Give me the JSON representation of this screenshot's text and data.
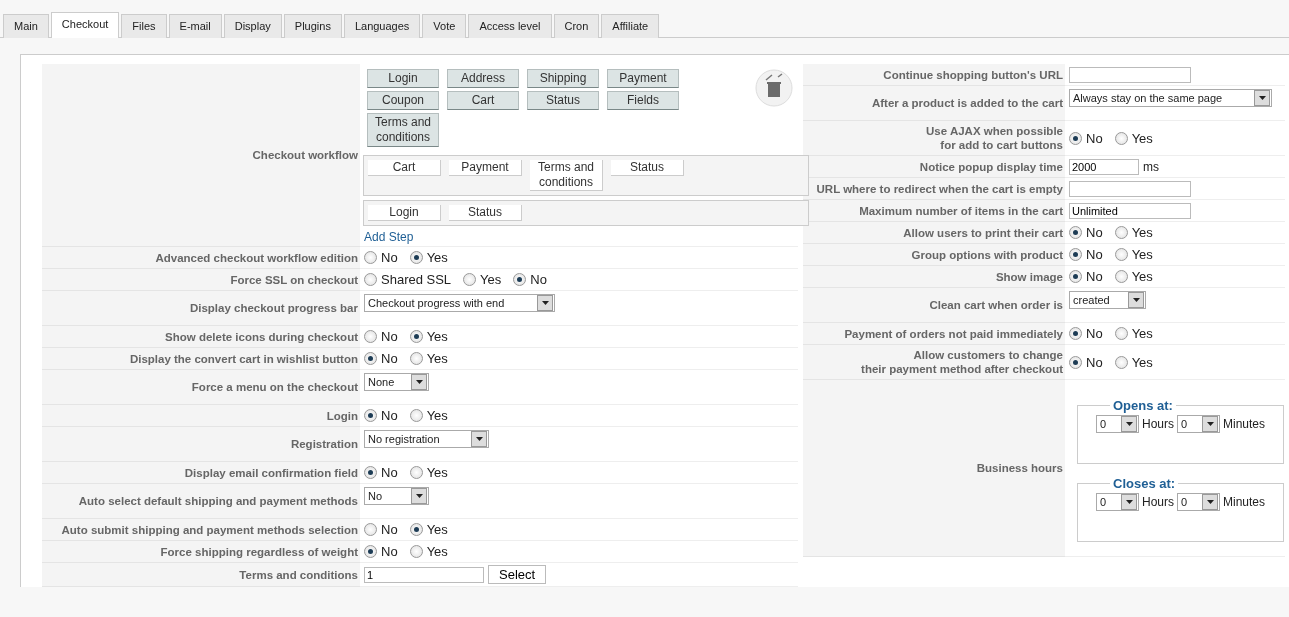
{
  "tabs": [
    {
      "label": "Main",
      "selected": false
    },
    {
      "label": "Checkout",
      "selected": true
    },
    {
      "label": "Files",
      "selected": false
    },
    {
      "label": "E-mail",
      "selected": false
    },
    {
      "label": "Display",
      "selected": false
    },
    {
      "label": "Plugins",
      "selected": false
    },
    {
      "label": "Languages",
      "selected": false
    },
    {
      "label": "Vote",
      "selected": false
    },
    {
      "label": "Access level",
      "selected": false
    },
    {
      "label": "Cron",
      "selected": false
    },
    {
      "label": "Affiliate",
      "selected": false
    }
  ],
  "left_rows": [
    {
      "kind": "workflow",
      "label": "Checkout workflow",
      "available": [
        "Login",
        "Address",
        "Shipping",
        "Payment",
        "Coupon",
        "Cart",
        "Status",
        "Fields",
        "Terms and conditions"
      ],
      "steps": [
        [
          "Cart",
          "Payment",
          "Terms and conditions",
          "Status"
        ],
        [
          "Login",
          "Status"
        ]
      ],
      "add_step": "Add Step"
    },
    {
      "kind": "radio",
      "label": "Advanced checkout workflow edition",
      "options": [
        {
          "label": "No",
          "selected": false
        },
        {
          "label": "Yes",
          "selected": true
        }
      ]
    },
    {
      "kind": "radio",
      "label": "Force SSL on checkout",
      "options": [
        {
          "label": "Shared SSL",
          "selected": false
        },
        {
          "label": "Yes",
          "selected": false
        },
        {
          "label": "No",
          "selected": true
        }
      ]
    },
    {
      "kind": "select",
      "label": "Display checkout progress bar",
      "value": "Checkout progress with end"
    },
    {
      "kind": "radio",
      "label": "Show delete icons during checkout",
      "options": [
        {
          "label": "No",
          "selected": false
        },
        {
          "label": "Yes",
          "selected": true
        }
      ]
    },
    {
      "kind": "radio",
      "label": "Display the convert cart in wishlist button",
      "options": [
        {
          "label": "No",
          "selected": true
        },
        {
          "label": "Yes",
          "selected": false
        }
      ]
    },
    {
      "kind": "select",
      "label": "Force a menu on the checkout",
      "value": "None"
    },
    {
      "kind": "radio",
      "label": "Login",
      "options": [
        {
          "label": "No",
          "selected": true
        },
        {
          "label": "Yes",
          "selected": false
        }
      ]
    },
    {
      "kind": "select",
      "label": "Registration",
      "value": "No registration"
    },
    {
      "kind": "radio",
      "label": "Display email confirmation field",
      "options": [
        {
          "label": "No",
          "selected": true
        },
        {
          "label": "Yes",
          "selected": false
        }
      ]
    },
    {
      "kind": "select",
      "label": "Auto select default shipping and payment methods",
      "value": "No"
    },
    {
      "kind": "radio",
      "label": "Auto submit shipping and payment methods selection",
      "options": [
        {
          "label": "No",
          "selected": false
        },
        {
          "label": "Yes",
          "selected": true
        }
      ]
    },
    {
      "kind": "radio",
      "label": "Force shipping regardless of weight",
      "options": [
        {
          "label": "No",
          "selected": true
        },
        {
          "label": "Yes",
          "selected": false
        }
      ]
    },
    {
      "kind": "text_button",
      "label": "Terms and conditions",
      "value": "1",
      "button": "Select"
    }
  ],
  "right_rows": [
    {
      "kind": "text",
      "label": "Continue shopping button's URL"
    },
    {
      "kind": "select",
      "label": "After a product is added to the cart",
      "value": "Always stay on the same page"
    },
    {
      "kind": "radio",
      "label": "Use AJAX when possible\nfor add to cart buttons",
      "options": [
        {
          "label": "No",
          "selected": true
        },
        {
          "label": "Yes",
          "selected": false
        }
      ]
    },
    {
      "kind": "text_unit",
      "label": "Notice popup display time",
      "value": "2000",
      "unit": "ms"
    },
    {
      "kind": "text",
      "label": "URL where to redirect when the cart is empty"
    },
    {
      "kind": "text",
      "label": "Maximum number of items in the cart",
      "value": "Unlimited"
    },
    {
      "kind": "radio",
      "label": "Allow users to print their cart",
      "options": [
        {
          "label": "No",
          "selected": true
        },
        {
          "label": "Yes",
          "selected": false
        }
      ]
    },
    {
      "kind": "radio",
      "label": "Group options with product",
      "options": [
        {
          "label": "No",
          "selected": true
        },
        {
          "label": "Yes",
          "selected": false
        }
      ]
    },
    {
      "kind": "radio",
      "label": "Show image",
      "options": [
        {
          "label": "No",
          "selected": true
        },
        {
          "label": "Yes",
          "selected": false
        }
      ]
    },
    {
      "kind": "select",
      "label": "Clean cart when order is",
      "value": "created"
    },
    {
      "kind": "radio",
      "label": "Payment of orders not paid immediately",
      "options": [
        {
          "label": "No",
          "selected": true
        },
        {
          "label": "Yes",
          "selected": false
        }
      ]
    },
    {
      "kind": "radio",
      "label": "Allow customers to change\ntheir payment method after checkout",
      "options": [
        {
          "label": "No",
          "selected": true
        },
        {
          "label": "Yes",
          "selected": false
        }
      ]
    },
    {
      "kind": "hours",
      "label": "Business hours",
      "groups": [
        {
          "title": "Opens at:",
          "hours_value": "0",
          "hours_label": "Hours",
          "minutes_value": "0",
          "minutes_label": "Minutes"
        },
        {
          "title": "Closes at:",
          "hours_value": "0",
          "hours_label": "Hours",
          "minutes_value": "0",
          "minutes_label": "Minutes"
        }
      ]
    }
  ]
}
